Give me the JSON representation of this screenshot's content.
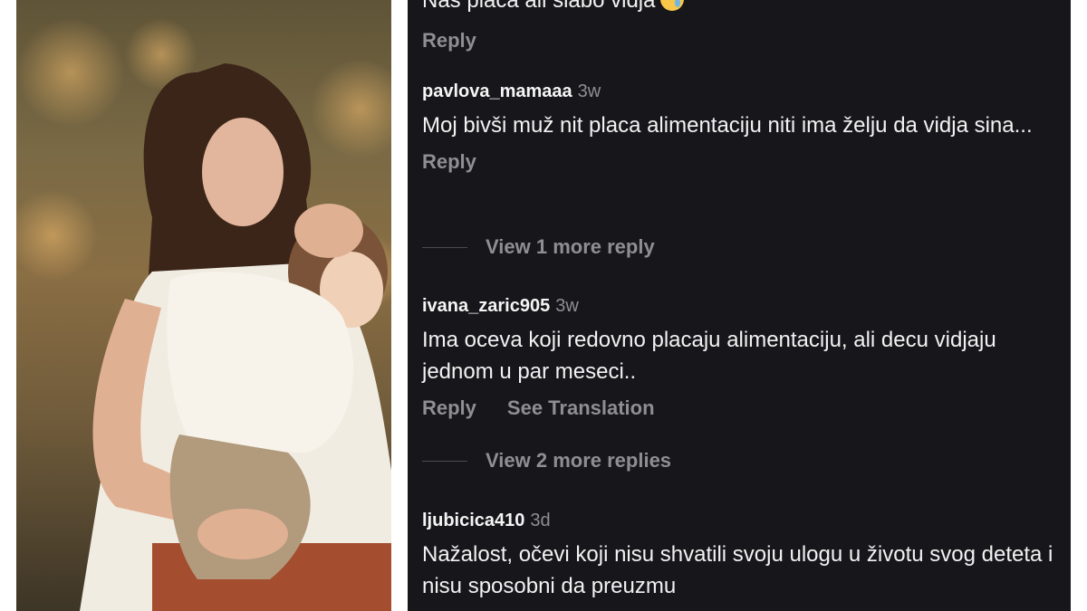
{
  "comments": [
    {
      "username": "",
      "time": "",
      "text": "Nas placa ali slabo vidja",
      "emoji": "crying-face-emoji",
      "reply_label": "Reply"
    },
    {
      "username": "pavlova_mamaaa",
      "time": "3w",
      "text": "Moj bivši muž nit placa alimentaciju niti ima želju da vidja sina...",
      "reply_label": "Reply",
      "view_more": "View 1 more reply"
    },
    {
      "username": "ivana_zaric905",
      "time": "3w",
      "text": "Ima oceva koji redovno placaju alimentaciju, ali decu vidjaju jednom u par meseci..",
      "reply_label": "Reply",
      "translation_label": "See Translation",
      "view_more": "View 2 more replies"
    },
    {
      "username": "ljubicica410",
      "time": "3d",
      "text": "Nažalost, očevi koji nisu shvatili svoju ulogu u životu svog deteta i nisu sposobni da preuzmu"
    }
  ],
  "colors": {
    "panel_bg": "#17171b",
    "text": "#f2f2f2",
    "muted": "#8e8e93"
  }
}
